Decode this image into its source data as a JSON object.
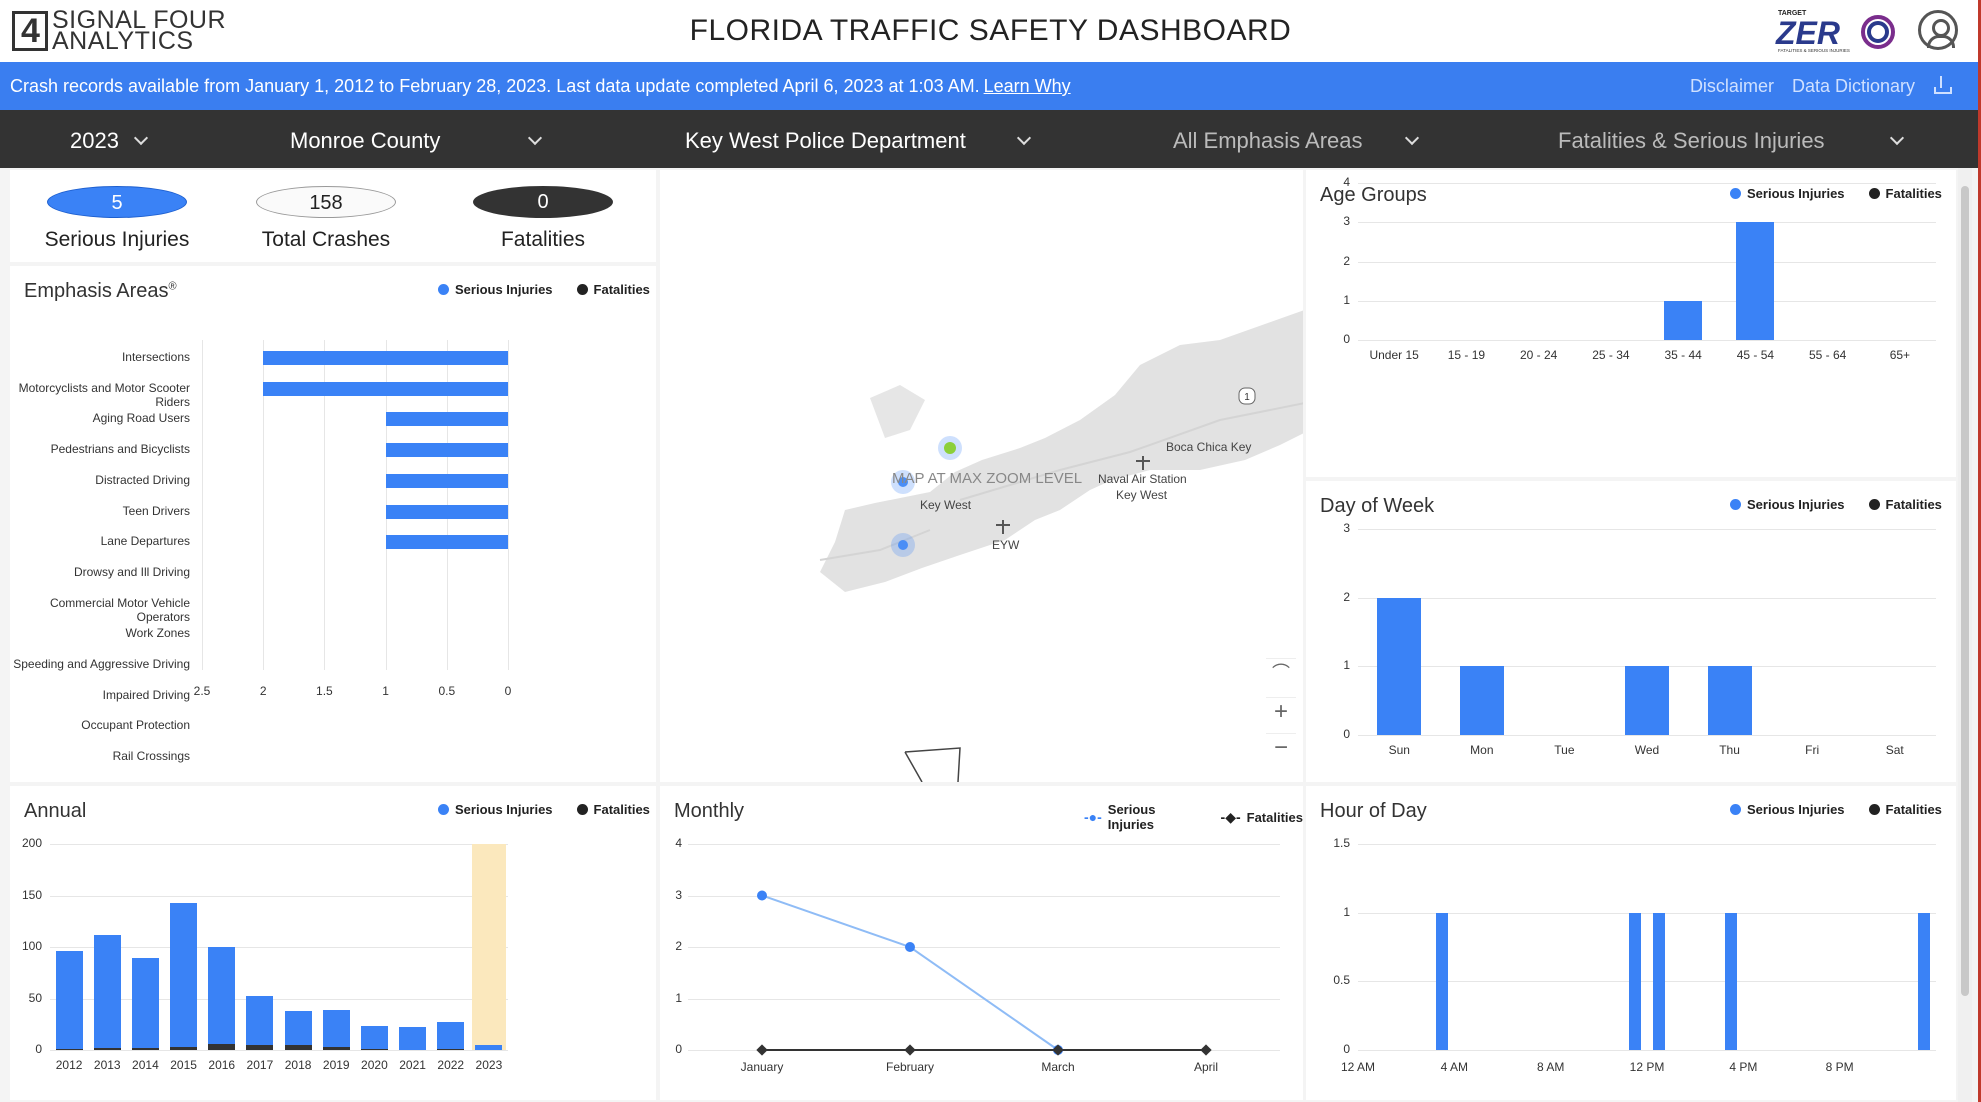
{
  "header": {
    "logo_line1": "SIGNAL FOUR",
    "logo_line2": "ANALYTICS",
    "title": "FLORIDA TRAFFIC SAFETY DASHBOARD",
    "target_zero": {
      "small": "TARGET",
      "big": "ZER",
      "tag": "FATALITIES & SERIOUS INJURIES"
    }
  },
  "infobar": {
    "notice": "Crash records available from January 1, 2012 to February 28, 2023. Last data update completed April 6, 2023 at 1:03 AM.",
    "learn_link": "Learn Why",
    "disclaimer": "Disclaimer",
    "dictionary": "Data Dictionary"
  },
  "filters": {
    "year": "2023",
    "county": "Monroe County",
    "agency": "Key West Police Department",
    "emphasis": "All Emphasis Areas",
    "severity": "Fatalities & Serious Injuries"
  },
  "summary": {
    "serious_value": "5",
    "serious_label": "Serious Injuries",
    "crashes_value": "158",
    "crashes_label": "Total Crashes",
    "fatal_value": "0",
    "fatal_label": "Fatalities"
  },
  "legend": {
    "serious": "Serious Injuries",
    "fatal": "Fatalities"
  },
  "colors": {
    "serious": "#3a82f6",
    "fatal": "#333333",
    "highlight": "#fbe8bd",
    "infobar": "#3a7ef0",
    "filterbar": "#333333"
  },
  "map": {
    "labels": {
      "max_zoom": "MAP AT MAX ZOOM LEVEL",
      "key_west": "Key West",
      "eyw": "EYW",
      "naval_1": "Naval Air Station",
      "naval_2": "Key West",
      "boca": "Boca Chica Key",
      "route": "1"
    },
    "icons": [
      "florida-icon",
      "zoom-in-icon",
      "zoom-out-icon",
      "airport-icon"
    ]
  },
  "chart_data": [
    {
      "id": "emphasis",
      "title": "Emphasis Areas",
      "type": "bar",
      "orientation": "horizontal",
      "categories": [
        "Intersections",
        "Motorcyclists and Motor Scooter Riders",
        "Aging Road Users",
        "Pedestrians and Bicyclists",
        "Distracted Driving",
        "Teen Drivers",
        "Lane Departures",
        "Drowsy and Ill Driving",
        "Commercial Motor Vehicle Operators",
        "Work Zones",
        "Speeding and Aggressive Driving",
        "Impaired Driving",
        "Occupant Protection",
        "Rail Crossings"
      ],
      "series": [
        {
          "name": "Serious Injuries",
          "values": [
            2,
            2,
            1,
            1,
            1,
            1,
            1,
            0,
            0,
            0,
            0,
            0,
            0,
            0
          ]
        },
        {
          "name": "Fatalities",
          "values": [
            0,
            0,
            0,
            0,
            0,
            0,
            0,
            0,
            0,
            0,
            0,
            0,
            0,
            0
          ]
        }
      ],
      "xlim": [
        0,
        2.5
      ],
      "ticks": [
        "2.5",
        "2",
        "1.5",
        "1",
        "0.5",
        "0"
      ],
      "tick_values": [
        2.5,
        2,
        1.5,
        1,
        0.5,
        0
      ],
      "x_reversed": true
    },
    {
      "id": "age",
      "title": "Age Groups",
      "type": "bar",
      "categories": [
        "Under 15",
        "15 - 19",
        "20 - 24",
        "25 - 34",
        "35 - 44",
        "45 - 54",
        "55 - 64",
        "65+"
      ],
      "series": [
        {
          "name": "Serious Injuries",
          "values": [
            0,
            0,
            0,
            0,
            1,
            3,
            0,
            0
          ]
        },
        {
          "name": "Fatalities",
          "values": [
            0,
            0,
            0,
            0,
            0,
            0,
            0,
            0
          ]
        }
      ],
      "ylim": [
        0,
        4
      ],
      "yticks": [
        "0",
        "1",
        "2",
        "3",
        "4"
      ],
      "ytick_values": [
        0,
        1,
        2,
        3,
        4
      ]
    },
    {
      "id": "dow",
      "title": "Day of Week",
      "type": "bar",
      "categories": [
        "Sun",
        "Mon",
        "Tue",
        "Wed",
        "Thu",
        "Fri",
        "Sat"
      ],
      "series": [
        {
          "name": "Serious Injuries",
          "values": [
            2,
            1,
            0,
            1,
            1,
            0,
            0
          ]
        },
        {
          "name": "Fatalities",
          "values": [
            0,
            0,
            0,
            0,
            0,
            0,
            0
          ]
        }
      ],
      "ylim": [
        0,
        3
      ],
      "yticks": [
        "0",
        "1",
        "2",
        "3"
      ],
      "ytick_values": [
        0,
        1,
        2,
        3
      ]
    },
    {
      "id": "annual",
      "title": "Annual",
      "type": "bar",
      "categories": [
        "2012",
        "2013",
        "2014",
        "2015",
        "2016",
        "2017",
        "2018",
        "2019",
        "2020",
        "2021",
        "2022",
        "2023"
      ],
      "series": [
        {
          "name": "Serious Injuries",
          "values": [
            96,
            112,
            89,
            143,
            100,
            52,
            38,
            39,
            23,
            22,
            27,
            5
          ]
        },
        {
          "name": "Fatalities",
          "values": [
            1,
            2,
            2,
            3,
            6,
            5,
            5,
            3,
            1,
            0,
            1,
            0
          ]
        }
      ],
      "highlight": "2023",
      "ylim": [
        0,
        200
      ],
      "yticks": [
        "0",
        "50",
        "100",
        "150",
        "200"
      ],
      "ytick_values": [
        0,
        50,
        100,
        150,
        200
      ]
    },
    {
      "id": "monthly",
      "title": "Monthly",
      "type": "line",
      "categories": [
        "January",
        "February",
        "March",
        "April"
      ],
      "series": [
        {
          "name": "Serious Injuries",
          "values": [
            3,
            2,
            0,
            null
          ]
        },
        {
          "name": "Fatalities",
          "values": [
            0,
            0,
            0,
            0
          ]
        }
      ],
      "ylim": [
        0,
        4
      ],
      "yticks": [
        "0",
        "1",
        "2",
        "3",
        "4"
      ],
      "ytick_values": [
        0,
        1,
        2,
        3,
        4
      ]
    },
    {
      "id": "hour",
      "title": "Hour of Day",
      "type": "bar",
      "x_hours": [
        0,
        1,
        2,
        3,
        4,
        5,
        6,
        7,
        8,
        9,
        10,
        11,
        12,
        13,
        14,
        15,
        16,
        17,
        18,
        19,
        20,
        21,
        22,
        23
      ],
      "series": [
        {
          "name": "Serious Injuries",
          "values": [
            0,
            0,
            0,
            1,
            0,
            0,
            0,
            0,
            0,
            0,
            0,
            1,
            1,
            0,
            0,
            1,
            0,
            0,
            0,
            0,
            0,
            0,
            0,
            1
          ]
        },
        {
          "name": "Fatalities",
          "values": [
            0,
            0,
            0,
            0,
            0,
            0,
            0,
            0,
            0,
            0,
            0,
            0,
            0,
            0,
            0,
            0,
            0,
            0,
            0,
            0,
            0,
            0,
            0,
            0
          ]
        }
      ],
      "xticks": [
        "12 AM",
        "4 AM",
        "8 AM",
        "12 PM",
        "4 PM",
        "8 PM"
      ],
      "xtick_hours": [
        0,
        4,
        8,
        12,
        16,
        20
      ],
      "ylim": [
        0,
        1.5
      ],
      "yticks": [
        "0",
        "0.5",
        "1",
        "1.5"
      ],
      "ytick_values": [
        0,
        0.5,
        1,
        1.5
      ]
    }
  ]
}
